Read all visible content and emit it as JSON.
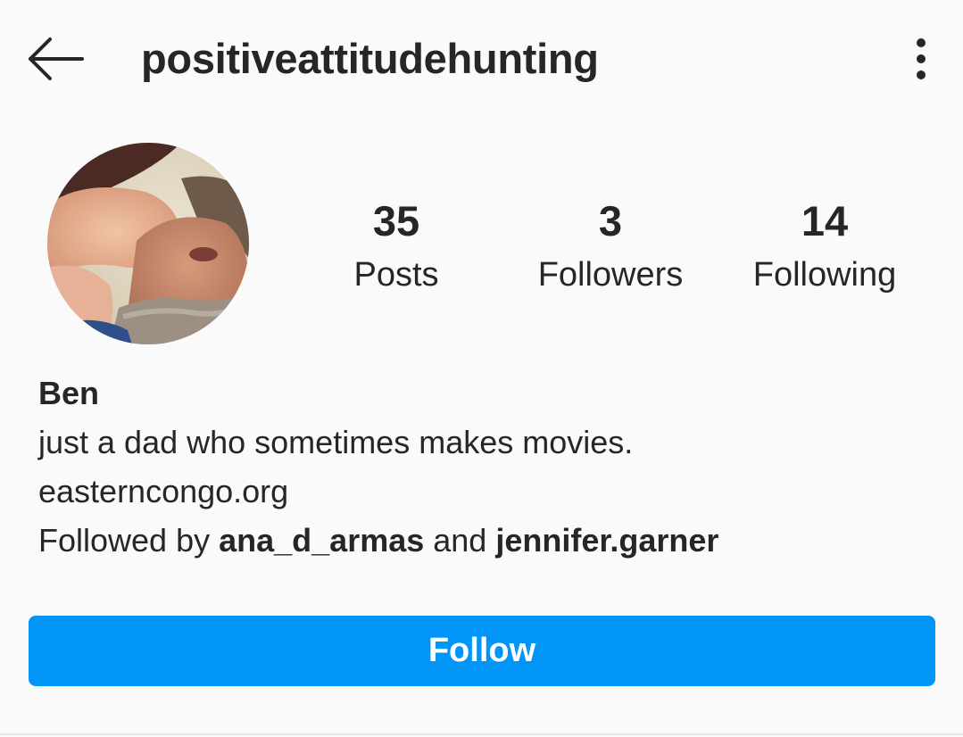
{
  "header": {
    "username": "positiveattitudehunting",
    "back_icon": "arrow-left-icon",
    "more_icon": "more-vertical-icon"
  },
  "profile": {
    "avatar": "profile-photo",
    "stats": {
      "posts": {
        "count": "35",
        "label": "Posts"
      },
      "followers": {
        "count": "3",
        "label": "Followers"
      },
      "following": {
        "count": "14",
        "label": "Following"
      }
    }
  },
  "bio": {
    "name": "Ben",
    "text": "just a dad who sometimes makes movies.",
    "link": "easterncongo.org",
    "followed_by_prefix": "Followed by ",
    "followed_by_user1": "ana_d_armas",
    "followed_by_conjunction": " and ",
    "followed_by_user2": "jennifer.garner"
  },
  "actions": {
    "follow_label": "Follow"
  },
  "colors": {
    "background": "#fafafa",
    "text": "#262626",
    "follow_button": "#0095f6",
    "follow_text": "#ffffff"
  }
}
